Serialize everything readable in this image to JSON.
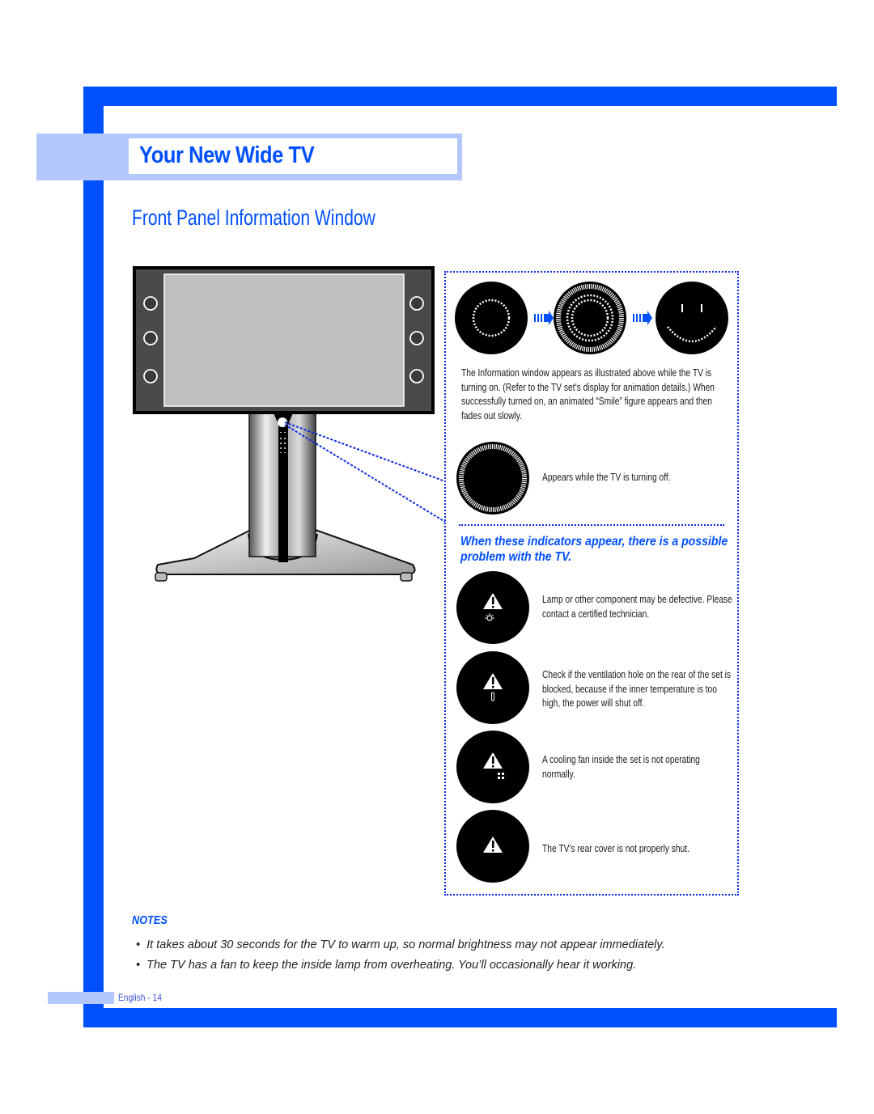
{
  "header": {
    "chapter_title": "Your New Wide TV",
    "section_title": "Front Panel Information Window"
  },
  "colors": {
    "brand_blue": "#0050ff",
    "band_light_blue": "#b4c8ff",
    "dotted_border": "#0a28e6"
  },
  "startup": {
    "sequence_icons": [
      "dotted-ring-icon",
      "multi-ring-icon",
      "smile-face-icon"
    ],
    "arrow_icon": "arrow-right-icon",
    "description": "The Information window appears as illustrated above while the TV is turning on. (Refer to the TV set’s display for animation details.) When successfully turned on, an animated “Smile” figure appears and then fades out slowly."
  },
  "shutdown": {
    "icon": "outer-ring-icon",
    "description": "Appears while the TV is turning off."
  },
  "warnings": {
    "heading": "When these indicators appear, there is a possible problem with the TV.",
    "items": [
      {
        "icon": "lamp-warning-icon",
        "text": "Lamp or other component may be defective. Please contact a certified technician."
      },
      {
        "icon": "temperature-warning-icon",
        "text": "Check if the ventilation hole on the rear of the set is blocked, because if the inner temperature is too high, the power will shut off."
      },
      {
        "icon": "fan-warning-icon",
        "text": "A cooling fan inside the set is not operating normally."
      },
      {
        "icon": "cover-warning-icon",
        "text": "The TV’s rear cover is not properly shut."
      }
    ]
  },
  "notes": {
    "title": "NOTES",
    "items": [
      "It takes about 30 seconds for the TV to warm up, so normal brightness may not appear immediately.",
      "The TV has a fan to keep the inside lamp from overheating. You’ll occasionally hear it working."
    ]
  },
  "footer": {
    "page_label": "English - 14"
  }
}
